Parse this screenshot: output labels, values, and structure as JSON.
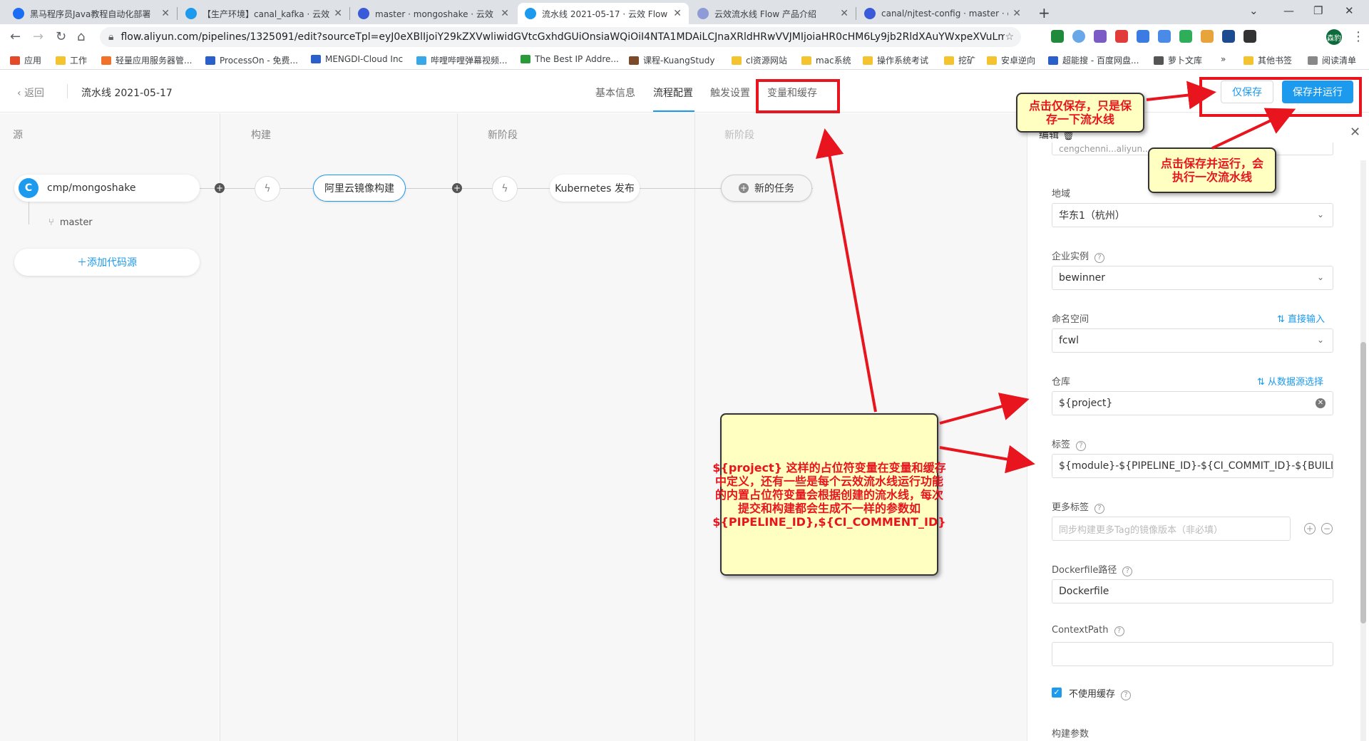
{
  "browser": {
    "tabs": [
      {
        "title": "黑马程序员Java教程自动化部署",
        "active": false,
        "color": "#1b6ef3"
      },
      {
        "title": "【生产环境】canal_kafka · 云效",
        "active": false,
        "color": "#1b9aee"
      },
      {
        "title": "master · mongoshake · 云效 Co",
        "active": false,
        "color": "#3a5bd9"
      },
      {
        "title": "流水线 2021-05-17 · 云效 Flow",
        "active": true,
        "color": "#1b9aee"
      },
      {
        "title": "云效流水线 Flow 产品介绍",
        "active": false,
        "color": "#8e9bd6"
      },
      {
        "title": "canal/njtest-config · master · c",
        "active": false,
        "color": "#3a5bd9"
      }
    ],
    "url": "flow.aliyun.com/pipelines/1325091/edit?sourceTpl=eyJ0eXBlIjoiY29kZXVwliwidGVtcGxhdGUiOnsiaWQiOiI4NTA1MDAiLCJnaXRldHRwVVJMIjoiaHR0cHM6Ly9jb2RldXAuYWxpeXVuLmNv...",
    "bookmarks": [
      "应用",
      "工作",
      "轻量应用服务器管...",
      "ProcessOn - 免费...",
      "MENGDI-Cloud Inc",
      "哔哩哔哩弹幕视频...",
      "The Best IP Addre...",
      "课程-KuangStudy",
      "cl资源网站",
      "mac系统",
      "操作系统考试",
      "挖矿",
      "安卓逆向",
      "超能搜 - 百度网盘...",
      "萝卜文库",
      "»",
      "其他书签",
      "阅读清单"
    ],
    "profile": "森豹"
  },
  "header": {
    "back": "返回",
    "title": "流水线 2021-05-17",
    "tabs": [
      "基本信息",
      "流程配置",
      "触发设置",
      "变量和缓存"
    ],
    "save_only": "仅保存",
    "save_run": "保存并运行"
  },
  "stages": [
    "源",
    "构建",
    "新阶段",
    "新阶段"
  ],
  "source": {
    "repo": "cmp/mongoshake",
    "branch": "master",
    "add": "添加代码源"
  },
  "tasks": {
    "build": "阿里云镜像构建",
    "deploy": "Kubernetes 发布",
    "new": "新的任务"
  },
  "panel": {
    "title": "编辑",
    "partial_top": "cengchenni...aliyun...",
    "region_label": "地域",
    "region_value": "华东1（杭州）",
    "instance_label": "企业实例",
    "instance_value": "bewinner",
    "namespace_label": "命名空间",
    "namespace_link": "直接输入",
    "namespace_value": "fcwl",
    "repo_label": "仓库",
    "repo_link": "从数据源选择",
    "repo_value": "${project}",
    "tag_label": "标签",
    "tag_value": "${module}-${PIPELINE_ID}-${CI_COMMIT_ID}-${BUILD_N",
    "more_tags_label": "更多标签",
    "more_tags_placeholder": "同步构建更多Tag的镜像版本（非必填）",
    "dockerfile_label": "Dockerfile路径",
    "dockerfile_value": "Dockerfile",
    "context_label": "ContextPath",
    "context_value": "",
    "nocache_label": "不使用缓存",
    "build_args_label": "构建参数"
  },
  "annotations": {
    "note_save": "点击仅保存，只是保存一下流水线",
    "note_run": "点击保存并运行，会执行一次流水线",
    "note_vars": "${project} 这样的占位符变量在变量和缓存中定义，还有一些是每个云效流水线运行功能的内置占位符变量会根据创建的流水线，每次提交和构建都会生成不一样的参数如${PIPELINE_ID},${CI_COMMENT_ID}"
  },
  "colors": {
    "accent": "#1b9aee",
    "annotation_red": "#e8141e",
    "note_bg": "#ffffc2"
  }
}
